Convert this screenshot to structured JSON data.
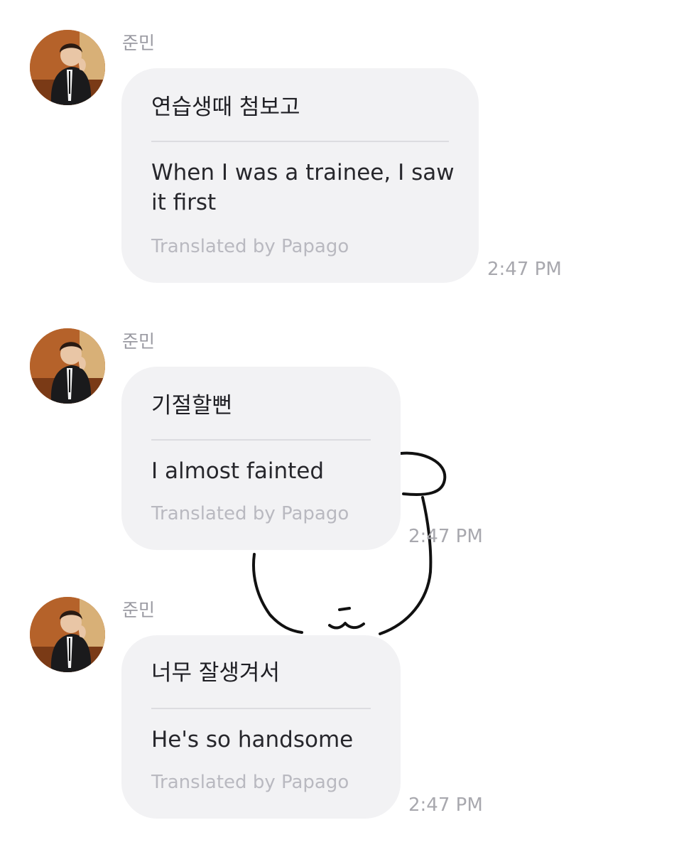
{
  "messages": [
    {
      "sender": "준민",
      "original": "연습생때 첨보고",
      "translation": "When I was a trainee, I saw it first",
      "credit": "Translated by Papago",
      "time": "2:47 PM"
    },
    {
      "sender": "준민",
      "original": "기절할뻔",
      "translation": "I almost fainted",
      "credit": "Translated by Papago",
      "time": "2:47 PM"
    },
    {
      "sender": "준민",
      "original": "너무 잘생겨서",
      "translation": "He's so handsome",
      "credit": "Translated by Papago",
      "time": "2:47 PM"
    }
  ],
  "colors": {
    "bubble": "#f2f2f4",
    "sender": "#9a9aa2",
    "credit": "#b9b9c0",
    "time": "#a8a8ae"
  }
}
